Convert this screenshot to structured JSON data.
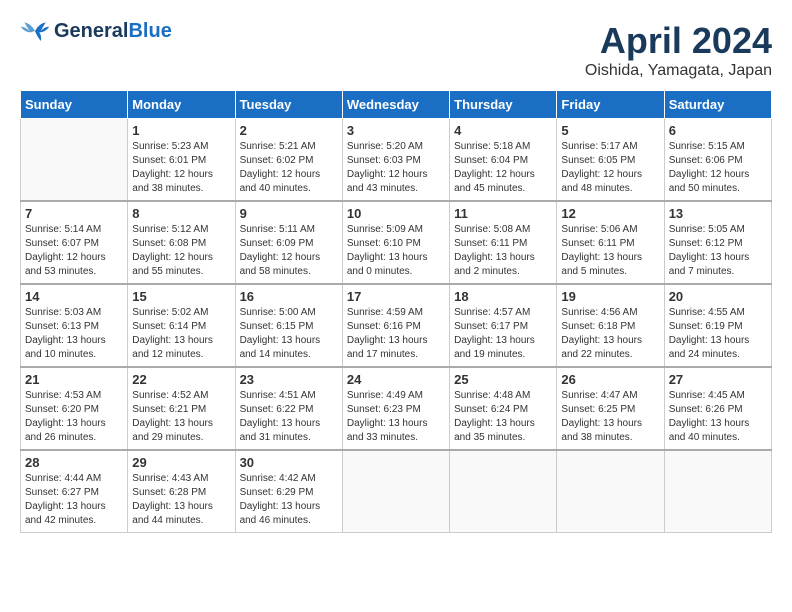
{
  "header": {
    "logo_line1": "General",
    "logo_line2": "Blue",
    "title": "April 2024",
    "subtitle": "Oishida, Yamagata, Japan"
  },
  "weekdays": [
    "Sunday",
    "Monday",
    "Tuesday",
    "Wednesday",
    "Thursday",
    "Friday",
    "Saturday"
  ],
  "weeks": [
    [
      {
        "day": "",
        "info": ""
      },
      {
        "day": "1",
        "info": "Sunrise: 5:23 AM\nSunset: 6:01 PM\nDaylight: 12 hours\nand 38 minutes."
      },
      {
        "day": "2",
        "info": "Sunrise: 5:21 AM\nSunset: 6:02 PM\nDaylight: 12 hours\nand 40 minutes."
      },
      {
        "day": "3",
        "info": "Sunrise: 5:20 AM\nSunset: 6:03 PM\nDaylight: 12 hours\nand 43 minutes."
      },
      {
        "day": "4",
        "info": "Sunrise: 5:18 AM\nSunset: 6:04 PM\nDaylight: 12 hours\nand 45 minutes."
      },
      {
        "day": "5",
        "info": "Sunrise: 5:17 AM\nSunset: 6:05 PM\nDaylight: 12 hours\nand 48 minutes."
      },
      {
        "day": "6",
        "info": "Sunrise: 5:15 AM\nSunset: 6:06 PM\nDaylight: 12 hours\nand 50 minutes."
      }
    ],
    [
      {
        "day": "7",
        "info": "Sunrise: 5:14 AM\nSunset: 6:07 PM\nDaylight: 12 hours\nand 53 minutes."
      },
      {
        "day": "8",
        "info": "Sunrise: 5:12 AM\nSunset: 6:08 PM\nDaylight: 12 hours\nand 55 minutes."
      },
      {
        "day": "9",
        "info": "Sunrise: 5:11 AM\nSunset: 6:09 PM\nDaylight: 12 hours\nand 58 minutes."
      },
      {
        "day": "10",
        "info": "Sunrise: 5:09 AM\nSunset: 6:10 PM\nDaylight: 13 hours\nand 0 minutes."
      },
      {
        "day": "11",
        "info": "Sunrise: 5:08 AM\nSunset: 6:11 PM\nDaylight: 13 hours\nand 2 minutes."
      },
      {
        "day": "12",
        "info": "Sunrise: 5:06 AM\nSunset: 6:11 PM\nDaylight: 13 hours\nand 5 minutes."
      },
      {
        "day": "13",
        "info": "Sunrise: 5:05 AM\nSunset: 6:12 PM\nDaylight: 13 hours\nand 7 minutes."
      }
    ],
    [
      {
        "day": "14",
        "info": "Sunrise: 5:03 AM\nSunset: 6:13 PM\nDaylight: 13 hours\nand 10 minutes."
      },
      {
        "day": "15",
        "info": "Sunrise: 5:02 AM\nSunset: 6:14 PM\nDaylight: 13 hours\nand 12 minutes."
      },
      {
        "day": "16",
        "info": "Sunrise: 5:00 AM\nSunset: 6:15 PM\nDaylight: 13 hours\nand 14 minutes."
      },
      {
        "day": "17",
        "info": "Sunrise: 4:59 AM\nSunset: 6:16 PM\nDaylight: 13 hours\nand 17 minutes."
      },
      {
        "day": "18",
        "info": "Sunrise: 4:57 AM\nSunset: 6:17 PM\nDaylight: 13 hours\nand 19 minutes."
      },
      {
        "day": "19",
        "info": "Sunrise: 4:56 AM\nSunset: 6:18 PM\nDaylight: 13 hours\nand 22 minutes."
      },
      {
        "day": "20",
        "info": "Sunrise: 4:55 AM\nSunset: 6:19 PM\nDaylight: 13 hours\nand 24 minutes."
      }
    ],
    [
      {
        "day": "21",
        "info": "Sunrise: 4:53 AM\nSunset: 6:20 PM\nDaylight: 13 hours\nand 26 minutes."
      },
      {
        "day": "22",
        "info": "Sunrise: 4:52 AM\nSunset: 6:21 PM\nDaylight: 13 hours\nand 29 minutes."
      },
      {
        "day": "23",
        "info": "Sunrise: 4:51 AM\nSunset: 6:22 PM\nDaylight: 13 hours\nand 31 minutes."
      },
      {
        "day": "24",
        "info": "Sunrise: 4:49 AM\nSunset: 6:23 PM\nDaylight: 13 hours\nand 33 minutes."
      },
      {
        "day": "25",
        "info": "Sunrise: 4:48 AM\nSunset: 6:24 PM\nDaylight: 13 hours\nand 35 minutes."
      },
      {
        "day": "26",
        "info": "Sunrise: 4:47 AM\nSunset: 6:25 PM\nDaylight: 13 hours\nand 38 minutes."
      },
      {
        "day": "27",
        "info": "Sunrise: 4:45 AM\nSunset: 6:26 PM\nDaylight: 13 hours\nand 40 minutes."
      }
    ],
    [
      {
        "day": "28",
        "info": "Sunrise: 4:44 AM\nSunset: 6:27 PM\nDaylight: 13 hours\nand 42 minutes."
      },
      {
        "day": "29",
        "info": "Sunrise: 4:43 AM\nSunset: 6:28 PM\nDaylight: 13 hours\nand 44 minutes."
      },
      {
        "day": "30",
        "info": "Sunrise: 4:42 AM\nSunset: 6:29 PM\nDaylight: 13 hours\nand 46 minutes."
      },
      {
        "day": "",
        "info": ""
      },
      {
        "day": "",
        "info": ""
      },
      {
        "day": "",
        "info": ""
      },
      {
        "day": "",
        "info": ""
      }
    ]
  ]
}
